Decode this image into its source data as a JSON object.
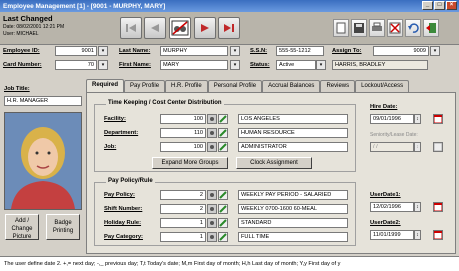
{
  "window": {
    "title": "Employee Management [1] - [9001 - MURPHY, MARY]"
  },
  "header": {
    "last_changed_label": "Last Changed",
    "date_text": "Date: 08/02/2001 12:21 PM",
    "user_text": "User: MICHAEL"
  },
  "fields": {
    "employee_id_label": "Employee ID:",
    "employee_id": "9001",
    "card_number_label": "Card Number:",
    "card_number": "70",
    "last_name_label": "Last Name:",
    "last_name": "MURPHY",
    "first_name_label": "First Name:",
    "first_name": "MARY",
    "ssn_label": "S.S.N:",
    "ssn": "555-55-1212",
    "status_label": "Status:",
    "status": "Active",
    "assign_to_label": "Assign To:",
    "assign_to_id": "9009",
    "assign_to_name": "HARRIS, BRADLEY",
    "job_title_label": "Job Title:",
    "job_title": "H.R. MANAGER"
  },
  "photo_buttons": {
    "add_change": "Add / Change Picture",
    "badge": "Badge Printing"
  },
  "tabs": [
    "Required",
    "Pay Profile",
    "H.R. Profile",
    "Personal Profile",
    "Accrual Balances",
    "Reviews",
    "Lockout/Access"
  ],
  "timekeeping": {
    "title": "Time Keeping / Cost Center Distribution",
    "rows": [
      {
        "label": "Facility:",
        "code": "100",
        "name": "LOS ANGELES"
      },
      {
        "label": "Department:",
        "code": "110",
        "name": "HUMAN RESOURCE"
      },
      {
        "label": "Job:",
        "code": "100",
        "name": "ADMINISTRATOR"
      }
    ],
    "expand_button": "Expand More Groups",
    "clock_button": "Clock Assignment"
  },
  "hire": {
    "hire_date_label": "Hire Date:",
    "hire_date": "09/01/1996",
    "seniority_label": "Seniority/Lease Date:",
    "seniority_date": "/ /"
  },
  "pay_policy": {
    "title": "Pay Policy/Rule",
    "rows": [
      {
        "label": "Pay Policy:",
        "code": "2",
        "name": "WEEKLY PAY PERIOD - SALARIED"
      },
      {
        "label": "Shift Number:",
        "code": "2",
        "name": "WEEKLY 0700-1600 60-MEAL"
      },
      {
        "label": "Holiday Rule:",
        "code": "1",
        "name": "STANDARD"
      },
      {
        "label": "Pay Category:",
        "code": "1",
        "name": "FULL TIME"
      }
    ]
  },
  "user_dates": {
    "user1_label": "UserDate1:",
    "user1": "12/02/1996",
    "user2_label": "UserDate2:",
    "user2": "11/01/1999"
  },
  "status_bar": "The user define date 2. +,= next day; -,_ previous day; T,t Today's date; M,m First day of month; H,h Last day of month; Y,y First day of y"
}
